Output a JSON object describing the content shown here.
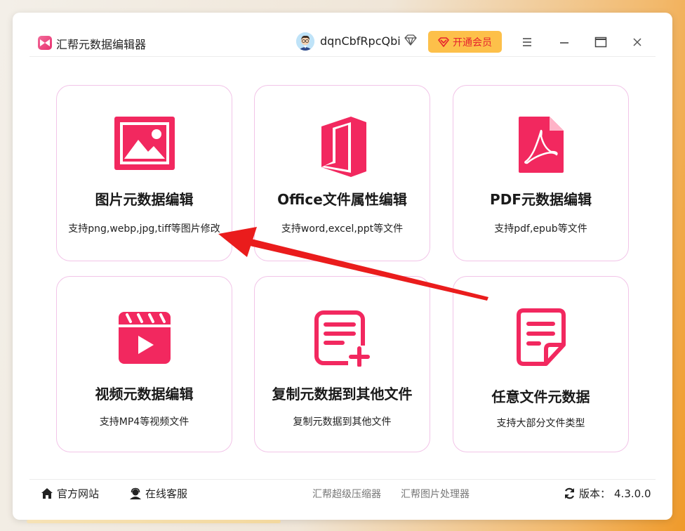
{
  "app": {
    "title": "汇帮元数据编辑器",
    "username": "dqnCbfRpcQbi",
    "vip_label": "开通会员"
  },
  "cards": [
    {
      "title": "图片元数据编辑",
      "desc": "支持png,webp,jpg,tiff等图片修改",
      "icon": "image-icon"
    },
    {
      "title": "Office文件属性编辑",
      "desc": "支持word,excel,ppt等文件",
      "icon": "office-icon"
    },
    {
      "title": "PDF元数据编辑",
      "desc": "支持pdf,epub等文件",
      "icon": "pdf-icon"
    },
    {
      "title": "视频元数据编辑",
      "desc": "支持MP4等视频文件",
      "icon": "video-icon"
    },
    {
      "title": "复制元数据到其他文件",
      "desc": "复制元数据到其他文件",
      "icon": "add-document-icon"
    },
    {
      "title": "任意文件元数据",
      "desc": "支持大部分文件类型",
      "icon": "document-icon"
    }
  ],
  "footer": {
    "website": "官方网站",
    "support": "在线客服",
    "link1": "汇帮超级压缩器",
    "link2": "汇帮图片处理器",
    "version_label": "版本：",
    "version": "4.3.0.0"
  },
  "colors": {
    "accent": "#f2285f",
    "vip_bg": "#fdc04a",
    "vip_text": "#e5232e",
    "card_border": "#f2c4e8",
    "annotation_arrow": "#ea1c1c"
  }
}
